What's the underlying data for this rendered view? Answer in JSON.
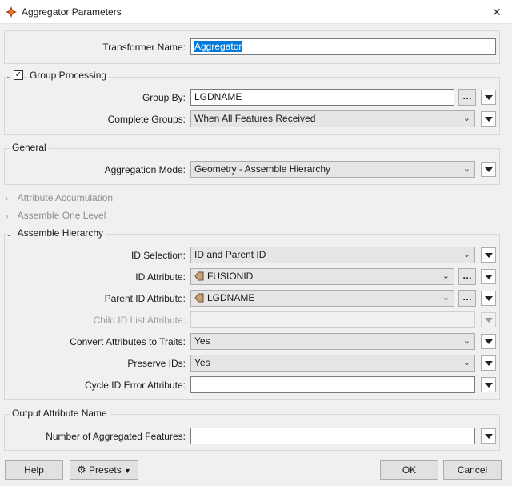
{
  "window": {
    "title": "Aggregator Parameters",
    "close_glyph": "✕"
  },
  "transformer_name": {
    "label": "Transformer Name:",
    "value": "Aggregator"
  },
  "group_processing": {
    "title": "Group Processing",
    "checked": true,
    "group_by_label": "Group By:",
    "group_by_value": "LGDNAME",
    "complete_groups_label": "Complete Groups:",
    "complete_groups_value": "When All Features Received"
  },
  "general": {
    "title": "General",
    "aggregation_mode_label": "Aggregation Mode:",
    "aggregation_mode_value": "Geometry - Assemble Hierarchy"
  },
  "collapsed_sections": {
    "attribute_accumulation": "Attribute Accumulation",
    "assemble_one_level": "Assemble One Level"
  },
  "assemble_hierarchy": {
    "title": "Assemble Hierarchy",
    "id_selection_label": "ID Selection:",
    "id_selection_value": "ID and Parent ID",
    "id_attribute_label": "ID Attribute:",
    "id_attribute_value": "FUSIONID",
    "parent_id_label": "Parent ID Attribute:",
    "parent_id_value": "LGDNAME",
    "child_id_label": "Child ID List Attribute:",
    "child_id_value": "",
    "convert_attrs_label": "Convert Attributes to Traits:",
    "convert_attrs_value": "Yes",
    "preserve_ids_label": "Preserve IDs:",
    "preserve_ids_value": "Yes",
    "cycle_id_label": "Cycle ID Error Attribute:",
    "cycle_id_value": ""
  },
  "output_attribute": {
    "title": "Output Attribute Name",
    "num_aggregated_label": "Number of Aggregated Features:",
    "num_aggregated_value": ""
  },
  "footer": {
    "help": "Help",
    "presets": "Presets",
    "ok": "OK",
    "cancel": "Cancel"
  },
  "icons": {
    "app": "fme-transformer-icon",
    "attribute": "attribute-tag-icon",
    "presets": "gear-icon"
  }
}
